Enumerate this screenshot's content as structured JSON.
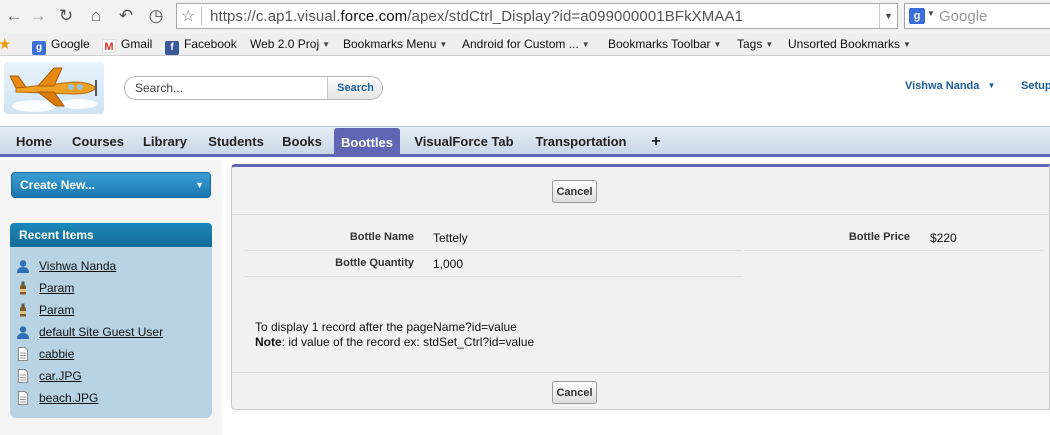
{
  "browser": {
    "url": "https://c.ap1.visual.force.com/apex/stdCtrl_Display?id=a099000001BFkXMAA1",
    "url_prefix": "https://c.ap1.visual.",
    "url_domain": "force.com",
    "url_path": "/apex/stdCtrl_Display?id=a099000001BFkXMAA1",
    "search_placeholder": "Google"
  },
  "bookmarks": [
    {
      "label": "Google",
      "icon": "google-icon",
      "color": "#3a6fd9"
    },
    {
      "label": "Gmail",
      "icon": "gmail-icon",
      "color": "#d93025"
    },
    {
      "label": "Facebook",
      "icon": "facebook-icon",
      "color": "#3b5998"
    },
    {
      "label": "Web 2.0 Proj",
      "folder": true
    },
    {
      "label": "Bookmarks Menu",
      "folder": true
    },
    {
      "label": "Android for Custom ...",
      "folder": true
    },
    {
      "label": "Bookmarks Toolbar",
      "folder": true
    },
    {
      "label": "Tags",
      "folder": true
    },
    {
      "label": "Unsorted Bookmarks",
      "folder": true
    }
  ],
  "header": {
    "search_placeholder": "Search...",
    "search_button": "Search",
    "user_name": "Vishwa Nanda",
    "setup": "Setup"
  },
  "tabs": [
    {
      "label": "Home"
    },
    {
      "label": "Courses"
    },
    {
      "label": "Library"
    },
    {
      "label": "Students"
    },
    {
      "label": "Books"
    },
    {
      "label": "Boottles",
      "active": true
    },
    {
      "label": "VisualForce Tab"
    },
    {
      "label": "Transportation"
    },
    {
      "label": "+"
    }
  ],
  "sidebar": {
    "create_new": "Create New...",
    "recent_title": "Recent Items",
    "recent_items": [
      {
        "label": "Vishwa Nanda",
        "icon": "user-icon"
      },
      {
        "label": "Param",
        "icon": "bottle-icon"
      },
      {
        "label": "Param",
        "icon": "bottle-icon"
      },
      {
        "label": "default Site Guest User",
        "icon": "user-icon"
      },
      {
        "label": "cabbie",
        "icon": "document-icon"
      },
      {
        "label": "car.JPG",
        "icon": "document-icon"
      },
      {
        "label": "beach.JPG",
        "icon": "document-icon"
      }
    ]
  },
  "detail": {
    "cancel_label": "Cancel",
    "fields": {
      "bottle_name_label": "Bottle Name",
      "bottle_name_value": "Tettely",
      "bottle_quantity_label": "Bottle Quantity",
      "bottle_quantity_value": "1,000",
      "bottle_price_label": "Bottle Price",
      "bottle_price_value": "$220"
    },
    "note_line1": "To display 1 record after the pageName?id=value",
    "note_label": "Note",
    "note_line2": ": id value of the record ex: stdSet_Ctrl?id=value"
  },
  "colors": {
    "tab_active": "#5f67b5",
    "sidebar_header": "#1b87b8",
    "recent_bg": "#b8d3e3",
    "link_blue": "#1d5d99"
  }
}
